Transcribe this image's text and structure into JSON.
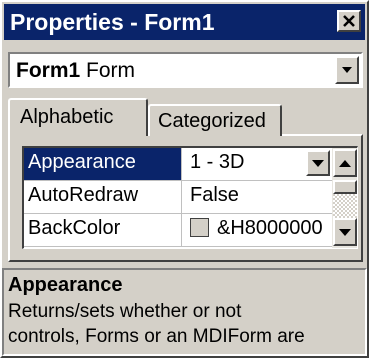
{
  "window": {
    "title": "Properties - Form1",
    "colors": {
      "titlebar": "#0a246a",
      "face": "#d4d0c8",
      "selection": "#0a246a"
    }
  },
  "object_selector": {
    "name": "Form1",
    "type": "Form"
  },
  "tabs": [
    {
      "label": "Alphabetic",
      "active": true
    },
    {
      "label": "Categorized",
      "active": false
    }
  ],
  "properties": [
    {
      "name": "Appearance",
      "value": "1 - 3D",
      "selected": true
    },
    {
      "name": "AutoRedraw",
      "value": "False",
      "selected": false
    },
    {
      "name": "BackColor",
      "value": "&H8000000",
      "selected": false
    }
  ],
  "description": {
    "title": "Appearance",
    "lines": [
      "Returns/sets whether or not",
      "controls, Forms or an MDIForm are"
    ]
  },
  "icons": {
    "close": "close-icon",
    "dropdown": "chevron-down-icon",
    "scroll_up": "arrow-up-icon",
    "scroll_down": "arrow-down-icon"
  }
}
